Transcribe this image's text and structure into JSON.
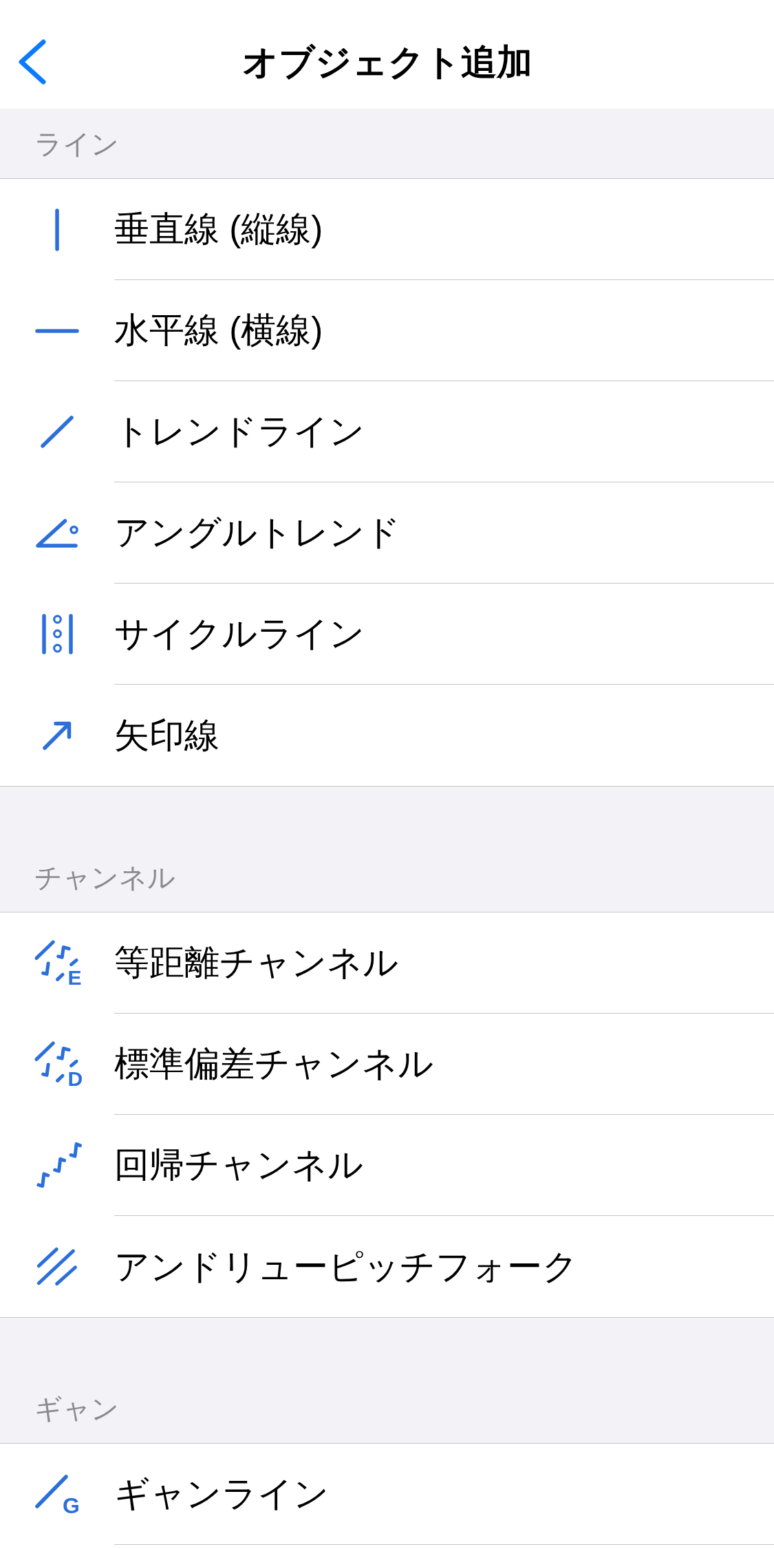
{
  "header": {
    "title": "オブジェクト追加"
  },
  "sections": [
    {
      "title": "ライン",
      "items": [
        {
          "kind": "vertical",
          "label": "垂直線 (縦線)"
        },
        {
          "kind": "horizontal",
          "label": "水平線 (横線)"
        },
        {
          "kind": "trend",
          "label": "トレンドライン"
        },
        {
          "kind": "angle",
          "label": "アングルトレンド"
        },
        {
          "kind": "cycle",
          "label": "サイクルライン"
        },
        {
          "kind": "arrow",
          "label": "矢印線"
        }
      ]
    },
    {
      "title": "チャンネル",
      "items": [
        {
          "kind": "equidistant",
          "label": "等距離チャンネル",
          "icon_letter": "E"
        },
        {
          "kind": "deviation",
          "label": "標準偏差チャンネル",
          "icon_letter": "D"
        },
        {
          "kind": "regression",
          "label": "回帰チャンネル"
        },
        {
          "kind": "pitchfork",
          "label": "アンドリューピッチフォーク"
        }
      ]
    },
    {
      "title": "ギャン",
      "items": [
        {
          "kind": "gann",
          "label": "ギャンライン",
          "icon_letter": "G"
        }
      ]
    }
  ]
}
